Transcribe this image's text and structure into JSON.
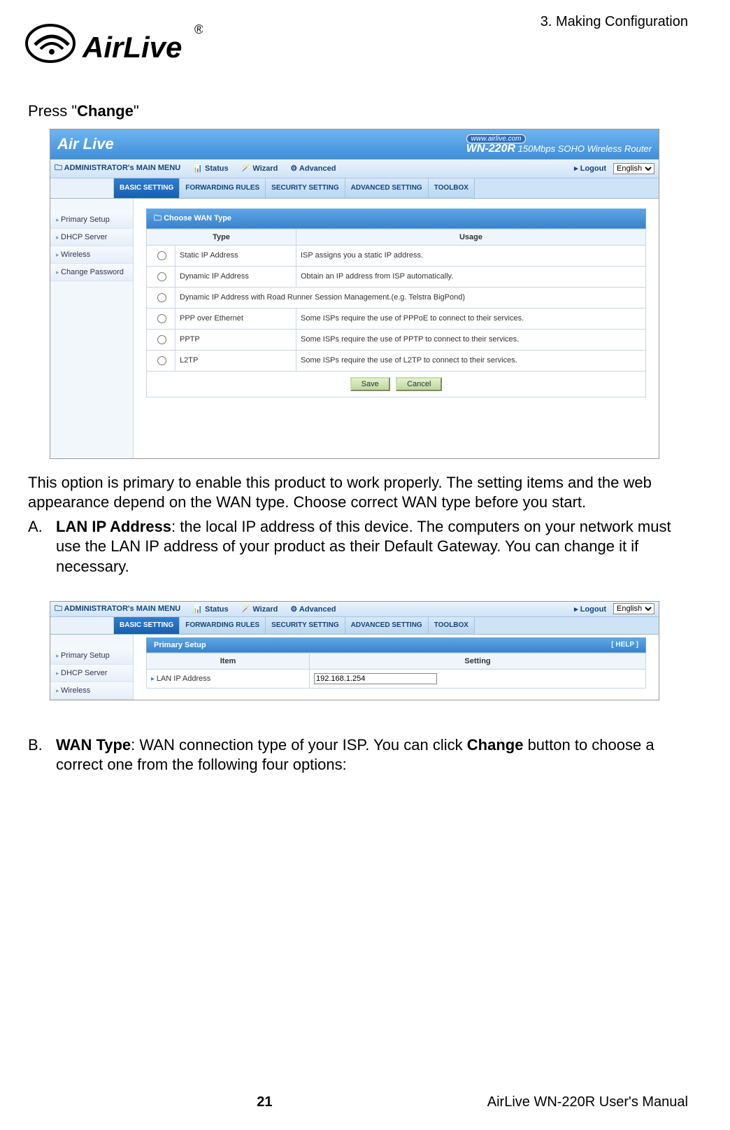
{
  "chapter_header": "3. Making Configuration",
  "logo_text_1": "Air",
  "logo_text_2": "Live",
  "intro_prefix": "Press \"",
  "intro_bold": "Change",
  "intro_suffix": "\"",
  "screenshot1": {
    "brand_logo": "Air Live",
    "url_pill": "www.airlive.com",
    "model_code": "WN-220R",
    "model_desc": "150Mbps SOHO Wireless Router",
    "menu_title": "ADMINISTRATOR's MAIN MENU",
    "menu_items": [
      "Status",
      "Wizard",
      "Advanced"
    ],
    "logout": "Logout",
    "language": "English",
    "tabs": [
      "BASIC SETTING",
      "FORWARDING RULES",
      "SECURITY SETTING",
      "ADVANCED SETTING",
      "TOOLBOX"
    ],
    "sidebar": [
      "Primary Setup",
      "DHCP Server",
      "Wireless",
      "Change Password"
    ],
    "panel_title": "Choose WAN Type",
    "col_type": "Type",
    "col_usage": "Usage",
    "rows": [
      {
        "type": "Static IP Address",
        "usage": "ISP assigns you a static IP address."
      },
      {
        "type": "Dynamic IP Address",
        "usage": "Obtain an IP address from ISP automatically."
      },
      {
        "type": "Dynamic IP Address with Road Runner Session Management.(e.g. Telstra BigPond)",
        "usage": ""
      },
      {
        "type": "PPP over Ethernet",
        "usage": "Some ISPs require the use of PPPoE to connect to their services."
      },
      {
        "type": "PPTP",
        "usage": "Some ISPs require the use of PPTP to connect to their services."
      },
      {
        "type": "L2TP",
        "usage": "Some ISPs require the use of L2TP to connect to their services."
      }
    ],
    "save_btn": "Save",
    "cancel_btn": "Cancel"
  },
  "paragraph_after_shot1": "This option is primary to enable this product to work properly. The setting items and the web appearance depend on the WAN type. Choose correct WAN type before you start.",
  "item_a_marker": "A.",
  "item_a_bold": "LAN IP Address",
  "item_a_rest": ": the local IP address of this device. The computers on your network must use the LAN IP address of your product as their Default Gateway. You can change it if necessary.",
  "screenshot2": {
    "menu_title": "ADMINISTRATOR's MAIN MENU",
    "menu_items": [
      "Status",
      "Wizard",
      "Advanced"
    ],
    "logout": "Logout",
    "language": "English",
    "tabs": [
      "BASIC SETTING",
      "FORWARDING RULES",
      "SECURITY SETTING",
      "ADVANCED SETTING",
      "TOOLBOX"
    ],
    "sidebar": [
      "Primary Setup",
      "DHCP Server",
      "Wireless"
    ],
    "panel_title": "Primary Setup",
    "help": "[ HELP ]",
    "col_item": "Item",
    "col_setting": "Setting",
    "row_item": "LAN IP Address",
    "row_value": "192.168.1.254"
  },
  "item_b_marker": "B.",
  "item_b_bold": "WAN Type",
  "item_b_mid": ": WAN connection type of your ISP. You can click ",
  "item_b_bold2": "Change",
  "item_b_rest": " button to choose a correct one from the following four options:",
  "page_number": "21",
  "footer_right": "AirLive WN-220R User's Manual"
}
